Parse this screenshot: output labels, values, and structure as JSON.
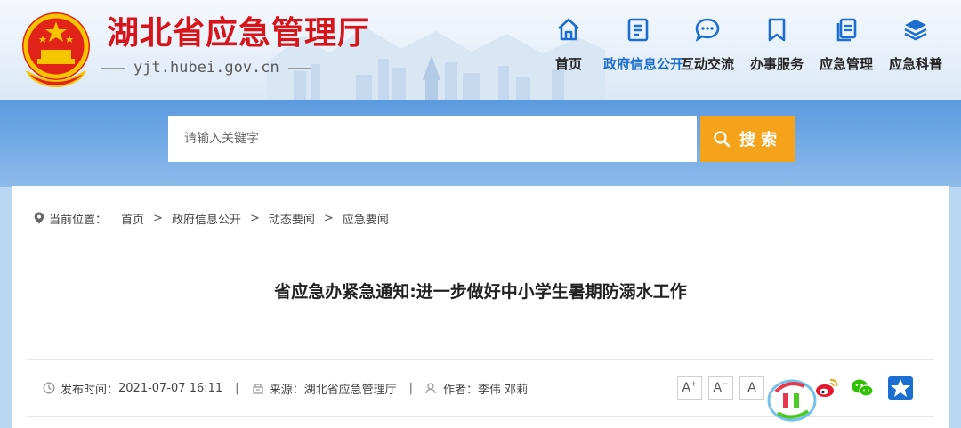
{
  "header": {
    "site_title": "湖北省应急管理厅",
    "site_domain": "yjt.hubei.gov.cn"
  },
  "nav": {
    "items": [
      {
        "label": "首页",
        "icon": "home-icon"
      },
      {
        "label": "政府信息公开",
        "icon": "document-icon",
        "active": true
      },
      {
        "label": "互动交流",
        "icon": "chat-bubble-icon"
      },
      {
        "label": "办事服务",
        "icon": "bookmark-icon"
      },
      {
        "label": "应急管理",
        "icon": "files-icon"
      },
      {
        "label": "应急科普",
        "icon": "layers-icon"
      }
    ]
  },
  "search": {
    "placeholder": "请输入关键字",
    "button_label": "搜索"
  },
  "breadcrumb": {
    "prefix": "当前位置：",
    "items": [
      "首页",
      "政府信息公开",
      "动态要闻",
      "应急要闻"
    ]
  },
  "article": {
    "title": "省应急办紧急通知:进一步做好中小学生暑期防溺水工作",
    "publish_label": "发布时间：",
    "publish_time": "2021-07-07 16:11",
    "source_label": "来源：",
    "source": "湖北省应急管理厅",
    "author_label": "作者：",
    "author": "李伟 邓莉"
  },
  "toolbar": {
    "font_increase": "A",
    "font_decrease": "A",
    "font_reset": "A",
    "share_icons": [
      "weibo-icon",
      "wechat-icon",
      "qq-zone-icon"
    ]
  },
  "colors": {
    "brand_red": "#d7141a",
    "nav_active": "#1c6fd1",
    "search_button": "#f5a31a",
    "band_blue": "#6aa5e4"
  }
}
